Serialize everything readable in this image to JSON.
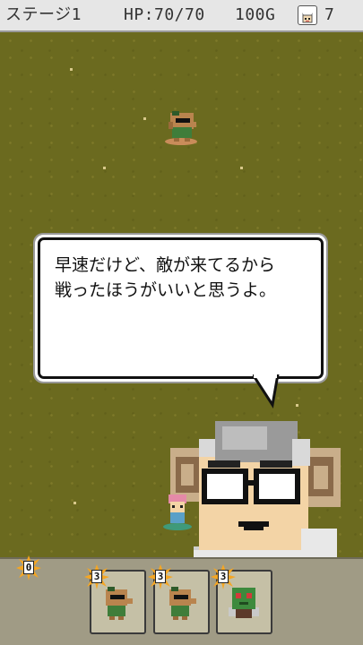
{
  "hud": {
    "stage": "ステージ1",
    "hp": "HP:70/70",
    "gold": "100G",
    "badge_icon": "cat-face-icon",
    "count": "7"
  },
  "dialog": {
    "text": "早速だけど、敵が来てるから\n戦ったほうがいいと思うよ。"
  },
  "timer": {
    "value": "0",
    "icon": "spark-burst-icon"
  },
  "cards": [
    {
      "cost": "3",
      "unit": "sunglasses-dog-unit-icon"
    },
    {
      "cost": "3",
      "unit": "sunglasses-dog-unit-icon"
    },
    {
      "cost": "3",
      "unit": "green-goblin-unit-icon"
    }
  ],
  "colors": {
    "grass": "#6b6a1f",
    "hud_bg": "#e6e6e6",
    "panel_bg": "#a09b85",
    "card_bg": "#c5c0a6",
    "spark": "#f5a623"
  }
}
